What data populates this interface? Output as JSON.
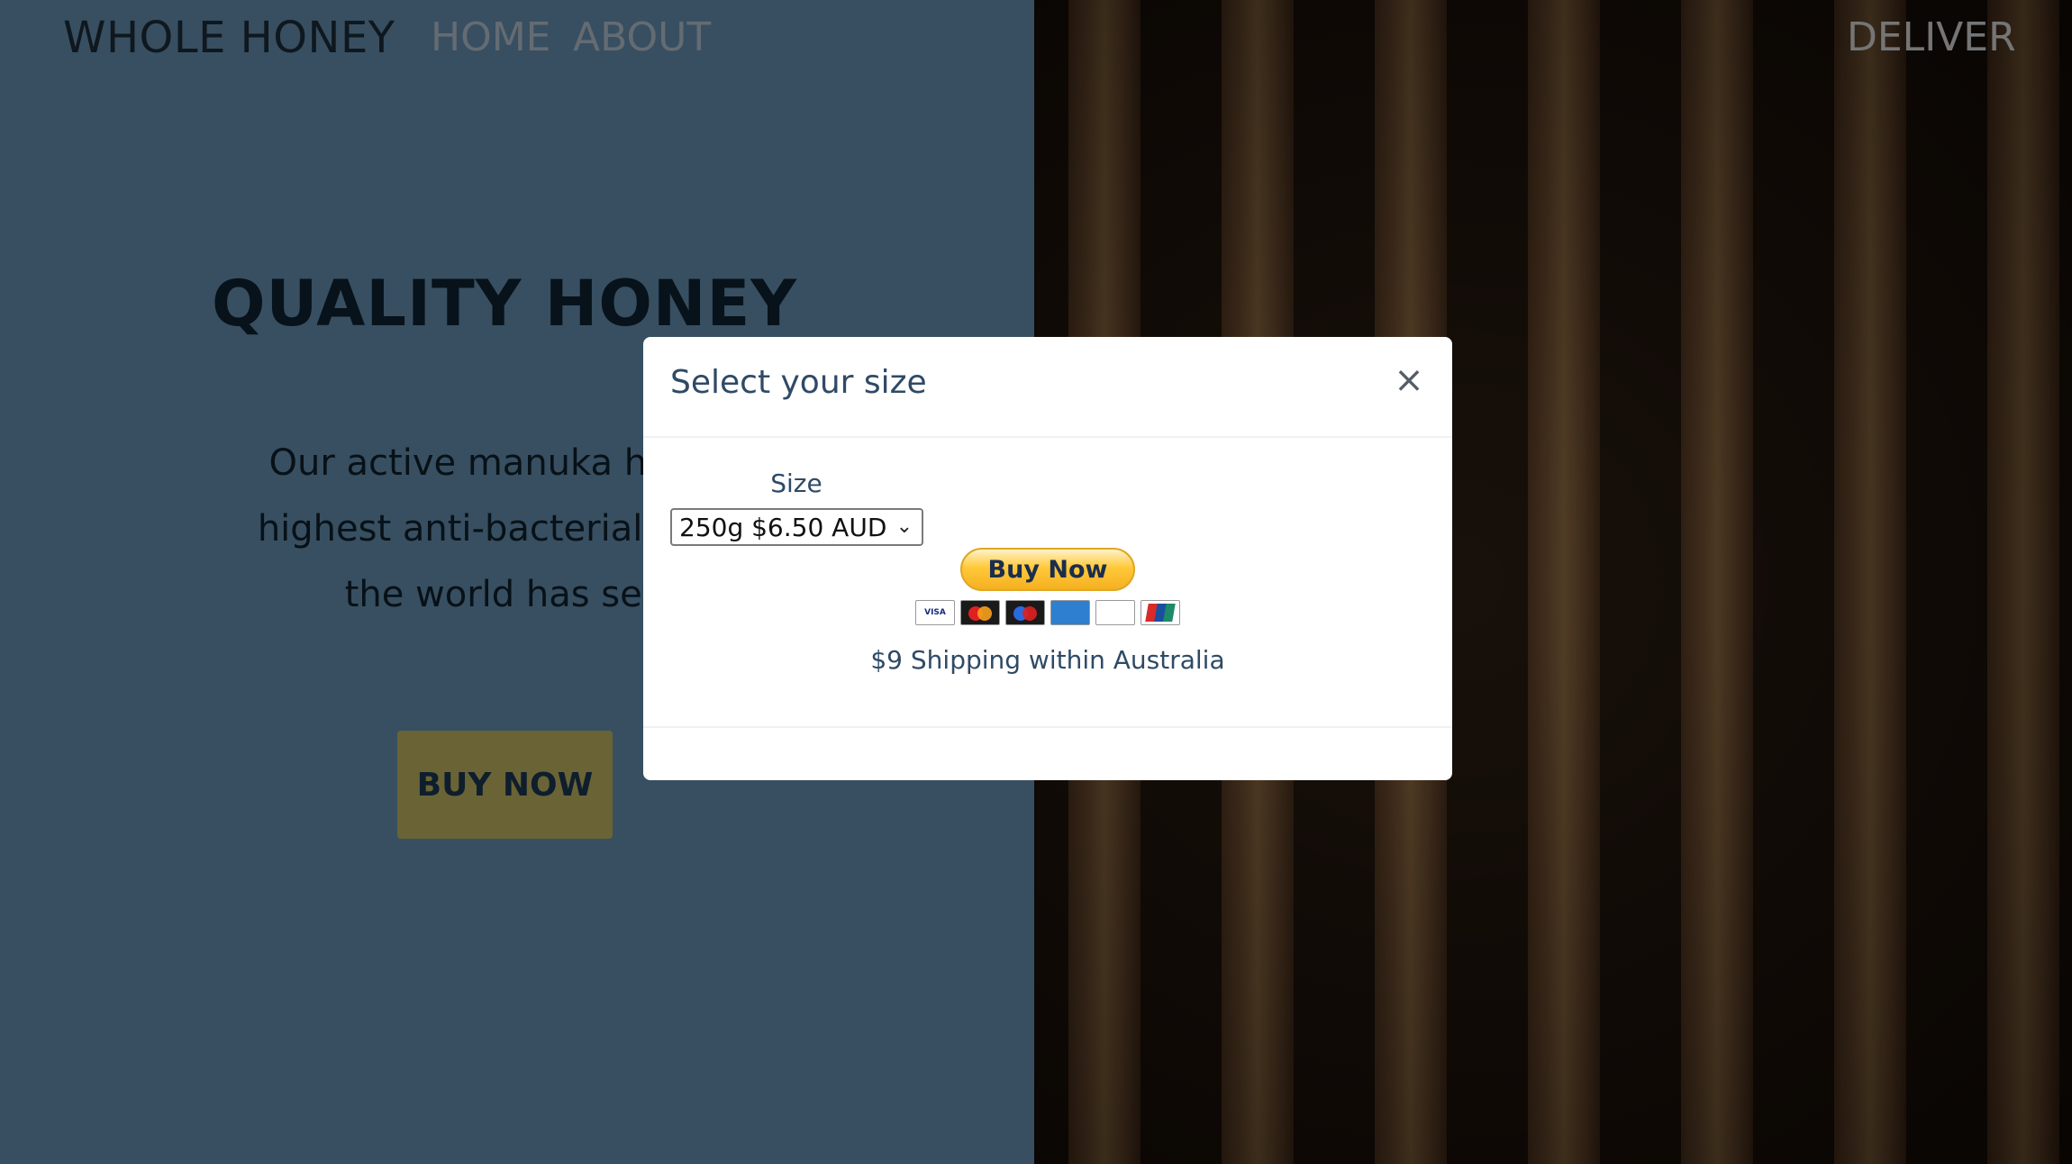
{
  "nav": {
    "brand": "WHOLE HONEY",
    "home": "HOME",
    "about": "ABOUT",
    "deliver": "DELIVER"
  },
  "hero": {
    "title": "QUALITY HONEY",
    "line1": "Our active manuka has so",
    "line2": "highest anti-bacterial activi",
    "line3": "the world has see",
    "buy_button": "BUY NOW"
  },
  "modal": {
    "title": "Select your size",
    "close_glyph": "×",
    "size_label": "Size",
    "selected_size": "250g $6.50 AUD",
    "paypal_button": "Buy Now",
    "cards": [
      "VISA",
      "Mastercard",
      "Maestro",
      "American Express",
      "Discover",
      "UnionPay"
    ],
    "shipping_note": "$9 Shipping within Australia"
  },
  "colors": {
    "hero_background": "#6f9ec2",
    "buy_button": "#d4c76a",
    "modal_text": "#2f4a66",
    "overlay": "rgba(0,0,0,0.5)"
  }
}
